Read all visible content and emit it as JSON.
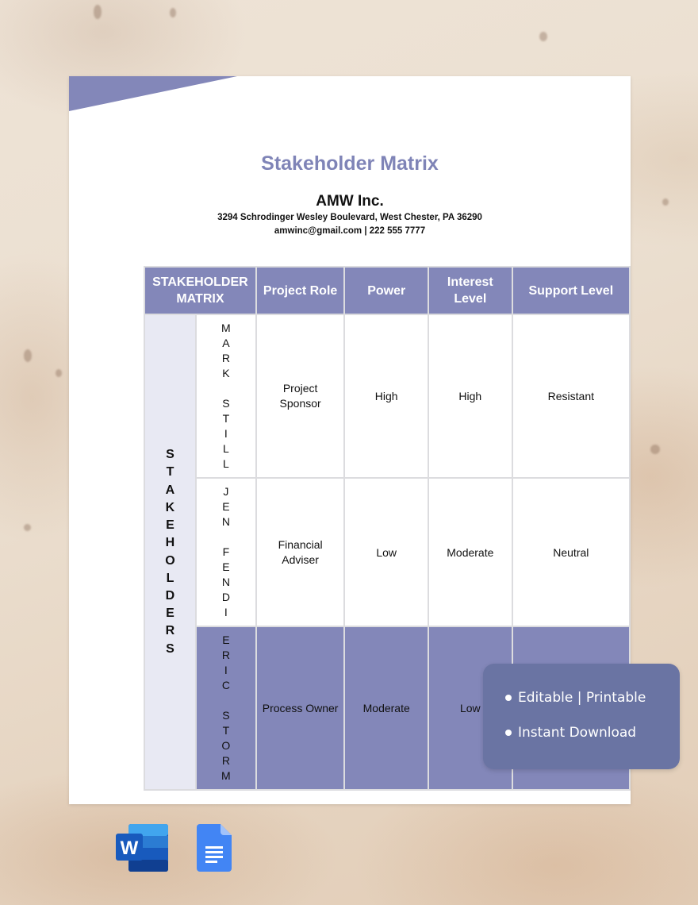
{
  "document": {
    "title": "Stakeholder Matrix",
    "company": "AMW Inc.",
    "address": "3294 Schrodinger Wesley Boulevard, West Chester, PA 36290",
    "contact": "amwinc@gmail.com | 222 555 7777",
    "accent_color": "#8387b9"
  },
  "table": {
    "headers": [
      "STAKEHOLDER MATRIX",
      "Project Role",
      "Power",
      "Interest Level",
      "Support Level"
    ],
    "header_lines": {
      "matrix": [
        "STAKEHOLDER",
        "MATRIX"
      ],
      "interest": [
        "Interest",
        "Level"
      ]
    },
    "group_label": "STAKEHOLDERS",
    "rows": [
      {
        "name": "MARK STILL",
        "role": "Project Sponsor",
        "role_lines": [
          "Project",
          "Sponsor"
        ],
        "power": "High",
        "interest": "High",
        "support": "Resistant"
      },
      {
        "name": "JEN FENDI",
        "role": "Financial Adviser",
        "role_lines": [
          "Financial",
          "Adviser"
        ],
        "power": "Low",
        "interest": "Moderate",
        "support": "Neutral"
      },
      {
        "name": "ERIC STORM",
        "role": "Process Owner",
        "role_lines": [
          "Process Owner"
        ],
        "power": "Moderate",
        "interest": "Low",
        "support": ""
      }
    ]
  },
  "badge": {
    "items": [
      "Editable | Printable",
      "Instant Download"
    ]
  },
  "app_icons": [
    {
      "name": "Microsoft Word",
      "icon": "word-icon"
    },
    {
      "name": "Google Docs",
      "icon": "google-docs-icon"
    }
  ]
}
